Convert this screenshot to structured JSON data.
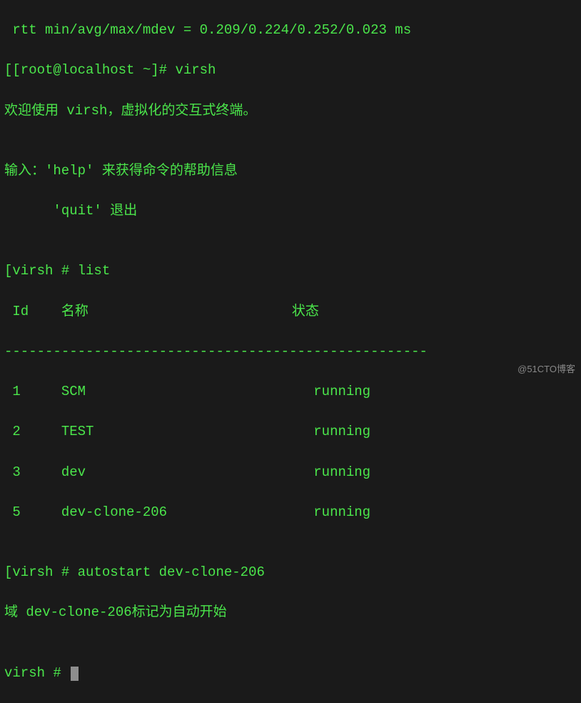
{
  "lines": {
    "l0": " rtt min/avg/max/mdev = 0.209/0.224/0.252/0.023 ms",
    "prompt1_open": "[",
    "prompt1": "[root@localhost ~]# ",
    "cmd1": "virsh",
    "l2": "欢迎使用 virsh，虚拟化的交互式终端。",
    "l3": "",
    "l4": "输入：'help' 来获得命令的帮助信息",
    "l5": "      'quit' 退出",
    "l6": "",
    "prompt2_open": "[",
    "prompt2": "virsh # ",
    "cmd2": "list",
    "header": " Id    名称                         状态",
    "dashes": "----------------------------------------------------",
    "r1": " 1     SCM                            running",
    "r2": " 2     TEST                           running",
    "r3": " 3     dev                            running",
    "r4": " 5     dev-clone-206                  running",
    "l_blank": "",
    "prompt3_open": "[",
    "prompt3": "virsh # ",
    "cmd3": "autostart dev-clone-206",
    "l_resp": "域 dev-clone-206标记为自动开始",
    "l_blank2": "",
    "prompt4": "virsh # "
  },
  "watermark": "@51CTO博客"
}
